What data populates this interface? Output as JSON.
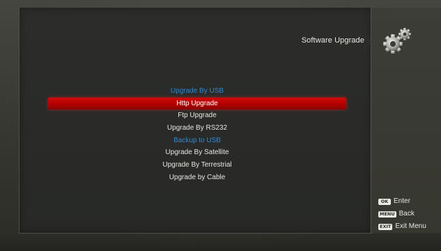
{
  "header": {
    "title": "Software Upgrade",
    "icon": "gears-icon"
  },
  "menu": {
    "items": [
      {
        "label": "Upgrade By USB",
        "state": "disabled"
      },
      {
        "label": "Http Upgrade",
        "state": "selected"
      },
      {
        "label": "Ftp Upgrade",
        "state": "normal"
      },
      {
        "label": "Upgrade By RS232",
        "state": "normal"
      },
      {
        "label": "Backup to USB",
        "state": "disabled"
      },
      {
        "label": "Upgrade By Satellite",
        "state": "normal"
      },
      {
        "label": "Upgrade By Terrestrial",
        "state": "normal"
      },
      {
        "label": "Upgrade by Cable",
        "state": "normal"
      }
    ]
  },
  "hints": {
    "enter": {
      "key": "OK",
      "label": "Enter"
    },
    "back": {
      "key": "MENU",
      "label": "Back"
    },
    "exit": {
      "key": "EXIT",
      "label": "Exit Menu"
    }
  },
  "colors": {
    "highlight": "#c00000",
    "disabled_text": "#2f88d4",
    "text": "#e6e6e2"
  }
}
